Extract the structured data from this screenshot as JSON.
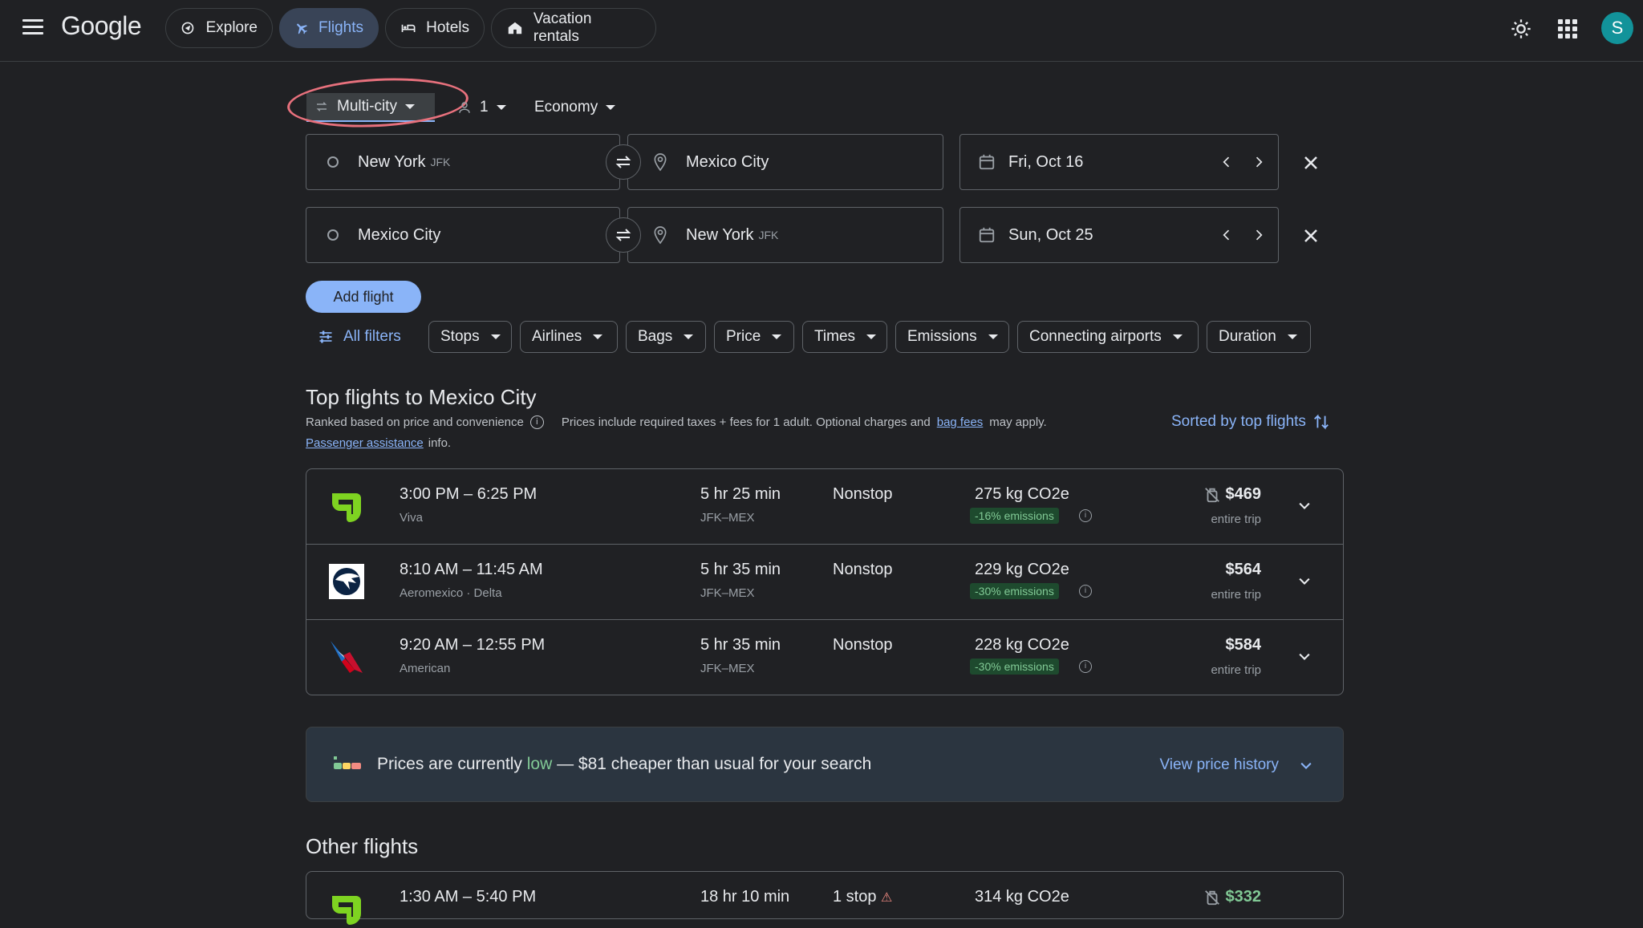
{
  "header": {
    "logo": "Google",
    "nav": [
      {
        "label": "Explore"
      },
      {
        "label": "Flights"
      },
      {
        "label": "Hotels"
      },
      {
        "label": "Vacation rentals"
      }
    ],
    "avatar_letter": "S"
  },
  "search": {
    "trip_type": "Multi-city",
    "passengers": "1",
    "cabin": "Economy",
    "legs": [
      {
        "origin": "New York",
        "origin_code": "JFK",
        "destination": "Mexico City",
        "destination_code": "",
        "date": "Fri, Oct 16"
      },
      {
        "origin": "Mexico City",
        "origin_code": "",
        "destination": "New York",
        "destination_code": "JFK",
        "date": "Sun, Oct 25"
      }
    ],
    "add_flight": "Add flight"
  },
  "filters": {
    "all": "All filters",
    "chips": [
      "Stops",
      "Airlines",
      "Bags",
      "Price",
      "Times",
      "Emissions",
      "Connecting airports",
      "Duration"
    ]
  },
  "results": {
    "title": "Top flights to Mexico City",
    "ranked": "Ranked based on price and convenience",
    "prices_note": "Prices include required taxes + fees for 1 adult. Optional charges and",
    "bag_fees": "bag fees",
    "may_apply": "may apply.",
    "passenger_assistance": "Passenger assistance",
    "info_suffix": "info.",
    "sorted": "Sorted by top flights",
    "flights": [
      {
        "times": "3:00 PM – 6:25 PM",
        "airline": "Viva",
        "duration": "5 hr 25 min",
        "route": "JFK–MEX",
        "stops": "Nonstop",
        "co2": "275 kg CO2e",
        "emissions": "-16% emissions",
        "price": "$469",
        "price_note": "entire trip"
      },
      {
        "times": "8:10 AM – 11:45 AM",
        "airline": "Aeromexico · Delta",
        "duration": "5 hr 35 min",
        "route": "JFK–MEX",
        "stops": "Nonstop",
        "co2": "229 kg CO2e",
        "emissions": "-30% emissions",
        "price": "$564",
        "price_note": "entire trip"
      },
      {
        "times": "9:20 AM – 12:55 PM",
        "airline": "American",
        "duration": "5 hr 35 min",
        "route": "JFK–MEX",
        "stops": "Nonstop",
        "co2": "228 kg CO2e",
        "emissions": "-30% emissions",
        "price": "$584",
        "price_note": "entire trip"
      }
    ]
  },
  "insight": {
    "pre": "Prices are currently",
    "level": "low",
    "post": "— $81 cheaper than usual for your search",
    "link": "View price history"
  },
  "other": {
    "title": "Other flights",
    "first": {
      "times": "1:30 AM – 5:40 PM",
      "duration": "18 hr 10 min",
      "stops": "1 stop",
      "co2": "314 kg CO2e",
      "price": "$332"
    }
  },
  "colors": {
    "accent": "#8ab4f8",
    "bg": "#202124",
    "green": "#81c995",
    "annotation": "#e8717d"
  }
}
